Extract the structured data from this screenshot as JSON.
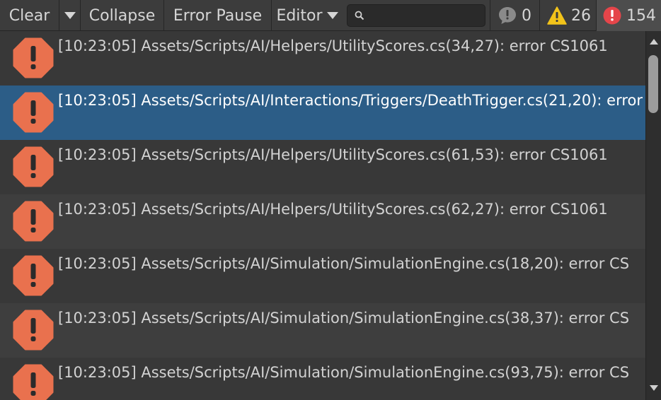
{
  "toolbar": {
    "clear_label": "Clear",
    "collapse_label": "Collapse",
    "error_pause_label": "Error Pause",
    "editor_label": "Editor",
    "search": {
      "value": "",
      "placeholder": ""
    },
    "counters": {
      "info": "0",
      "warnings": "26",
      "errors": "154"
    }
  },
  "colors": {
    "error_icon": "#e9714e",
    "warning_icon": "#f2c31a",
    "counter_error": "#e5454a",
    "selected_row": "#2c5d87"
  },
  "log": {
    "entries": [
      {
        "message": "[10:23:05] Assets/Scripts/AI/Helpers/UtilityScores.cs(34,27): error CS1061",
        "icon": "error-icon"
      },
      {
        "message": "[10:23:05] Assets/Scripts/AI/Interactions/Triggers/DeathTrigger.cs(21,20): error",
        "icon": "error-icon",
        "selected": true
      },
      {
        "message": "[10:23:05] Assets/Scripts/AI/Helpers/UtilityScores.cs(61,53): error CS1061",
        "icon": "error-icon"
      },
      {
        "message": "[10:23:05] Assets/Scripts/AI/Helpers/UtilityScores.cs(62,27): error CS1061",
        "icon": "error-icon"
      },
      {
        "message": "[10:23:05] Assets/Scripts/AI/Simulation/SimulationEngine.cs(18,20): error CS",
        "icon": "error-icon"
      },
      {
        "message": "[10:23:05] Assets/Scripts/AI/Simulation/SimulationEngine.cs(38,37): error CS",
        "icon": "error-icon"
      },
      {
        "message": "[10:23:05] Assets/Scripts/AI/Simulation/SimulationEngine.cs(93,75): error CS",
        "icon": "error-icon"
      }
    ]
  }
}
